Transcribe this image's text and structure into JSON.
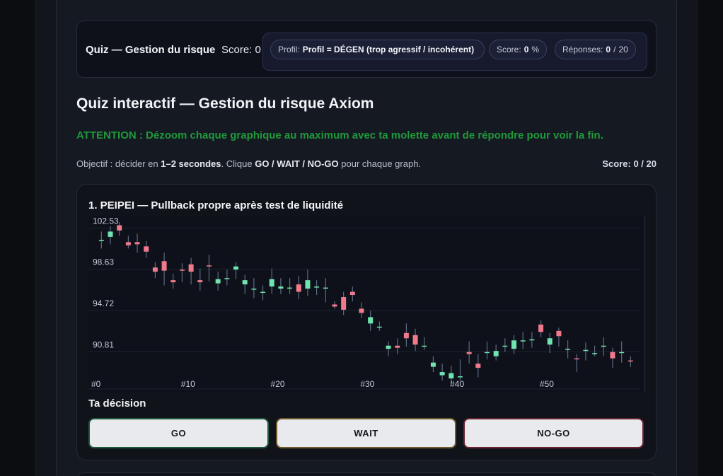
{
  "header": {
    "title": "Quiz — Gestion du risque",
    "score_text": "Score: 0",
    "profile_label": "Profil:",
    "profile_value": "Profil = DÉGEN (trop agressif / incohérent)",
    "score_label": "Score:",
    "score_value": "0",
    "score_unit": "%",
    "answers_label": "Réponses:",
    "answers_value": "0",
    "answers_sep": "/",
    "answers_total": "20"
  },
  "main": {
    "title": "Quiz interactif — Gestion du risque Axiom",
    "warning": "ATTENTION : Dézoom chaque graphique au maximum avec ta molette avant de répondre pour voir la fin.",
    "objective_prefix": "Objectif : décider en ",
    "objective_time": "1–2 secondes",
    "objective_mid": ". Clique ",
    "objective_buttons": "GO / WAIT / NO-GO",
    "objective_suffix": " pour chaque graph.",
    "score_summary": "Score: 0 / 20"
  },
  "question": {
    "title": "1. PEIPEI — Pullback propre après test de liquidité",
    "decision_label": "Ta décision",
    "buttons": {
      "go": "GO",
      "wait": "WAIT",
      "nogo": "NO-GO"
    }
  },
  "colors": {
    "up": "#6fe3b0",
    "down": "#f07a8c",
    "wick": "#5b6b86",
    "warning": "#1f9a3a",
    "chart_bg": "#0e1119"
  },
  "chart_data": {
    "type": "candlestick",
    "y_ticks": [
      "102.53",
      "98.63",
      "94.72",
      "90.81"
    ],
    "y_tick_values": [
      102.53,
      98.63,
      94.72,
      90.81
    ],
    "x_ticks": [
      "#0",
      "#10",
      "#20",
      "#30",
      "#40",
      "#50"
    ],
    "x_tick_values": [
      0,
      10,
      20,
      30,
      40,
      50
    ],
    "ylim": [
      87.9,
      103.3
    ],
    "xlim": [
      0,
      59
    ],
    "candles": [
      {
        "o": 101.4,
        "c": 101.4,
        "h": 102.2,
        "l": 100.6
      },
      {
        "o": 101.7,
        "c": 102.2,
        "h": 102.7,
        "l": 101.0
      },
      {
        "o": 102.8,
        "c": 102.3,
        "h": 103.1,
        "l": 101.8
      },
      {
        "o": 101.2,
        "c": 100.9,
        "h": 101.8,
        "l": 100.6
      },
      {
        "o": 101.2,
        "c": 101.0,
        "h": 102.0,
        "l": 100.2
      },
      {
        "o": 100.8,
        "c": 100.3,
        "h": 101.3,
        "l": 99.7
      },
      {
        "o": 98.8,
        "c": 98.4,
        "h": 99.3,
        "l": 97.8
      },
      {
        "o": 99.4,
        "c": 98.5,
        "h": 100.2,
        "l": 97.1
      },
      {
        "o": 97.6,
        "c": 97.4,
        "h": 98.2,
        "l": 96.8
      },
      {
        "o": 98.6,
        "c": 98.5,
        "h": 99.2,
        "l": 97.4
      },
      {
        "o": 99.1,
        "c": 98.4,
        "h": 99.7,
        "l": 97.2
      },
      {
        "o": 97.6,
        "c": 97.4,
        "h": 98.7,
        "l": 96.6
      },
      {
        "o": 99.0,
        "c": 98.9,
        "h": 100.0,
        "l": 97.5
      },
      {
        "o": 97.3,
        "c": 97.7,
        "h": 98.4,
        "l": 96.6
      },
      {
        "o": 97.7,
        "c": 97.8,
        "h": 98.6,
        "l": 97.1
      },
      {
        "o": 98.6,
        "c": 98.9,
        "h": 99.3,
        "l": 97.7
      },
      {
        "o": 97.2,
        "c": 97.6,
        "h": 98.1,
        "l": 96.3
      },
      {
        "o": 96.8,
        "c": 96.8,
        "h": 97.8,
        "l": 95.9
      },
      {
        "o": 96.5,
        "c": 96.5,
        "h": 97.1,
        "l": 95.7
      },
      {
        "o": 97.0,
        "c": 97.7,
        "h": 98.7,
        "l": 96.3
      },
      {
        "o": 96.8,
        "c": 97.0,
        "h": 97.8,
        "l": 96.3
      },
      {
        "o": 96.9,
        "c": 96.9,
        "h": 97.8,
        "l": 96.3
      },
      {
        "o": 97.2,
        "c": 96.5,
        "h": 98.0,
        "l": 95.8
      },
      {
        "o": 96.8,
        "c": 97.6,
        "h": 98.6,
        "l": 96.1
      },
      {
        "o": 97.0,
        "c": 97.0,
        "h": 97.6,
        "l": 96.2
      },
      {
        "o": 96.9,
        "c": 96.9,
        "h": 97.8,
        "l": 95.5
      },
      {
        "o": 95.3,
        "c": 95.1,
        "h": 95.6,
        "l": 94.9
      },
      {
        "o": 96.0,
        "c": 94.8,
        "h": 96.5,
        "l": 94.3
      },
      {
        "o": 96.5,
        "c": 96.2,
        "h": 97.0,
        "l": 95.6
      },
      {
        "o": 94.9,
        "c": 94.5,
        "h": 95.5,
        "l": 94.0
      },
      {
        "o": 93.5,
        "c": 94.1,
        "h": 94.7,
        "l": 92.8
      },
      {
        "o": 93.2,
        "c": 93.2,
        "h": 93.7,
        "l": 92.8
      },
      {
        "o": 91.1,
        "c": 91.4,
        "h": 91.8,
        "l": 90.4
      },
      {
        "o": 91.4,
        "c": 91.2,
        "h": 92.1,
        "l": 90.6
      },
      {
        "o": 92.6,
        "c": 92.1,
        "h": 93.5,
        "l": 91.3
      },
      {
        "o": 92.4,
        "c": 91.5,
        "h": 93.0,
        "l": 90.9
      },
      {
        "o": 91.4,
        "c": 91.4,
        "h": 92.2,
        "l": 91.0
      },
      {
        "o": 89.4,
        "c": 89.8,
        "h": 90.4,
        "l": 88.9
      },
      {
        "o": 88.6,
        "c": 88.9,
        "h": 89.7,
        "l": 88.1
      },
      {
        "o": 88.3,
        "c": 88.8,
        "h": 89.5,
        "l": 87.9
      },
      {
        "o": 88.5,
        "c": 88.5,
        "h": 90.1,
        "l": 88.1
      },
      {
        "o": 90.8,
        "c": 90.6,
        "h": 91.8,
        "l": 89.7
      },
      {
        "o": 89.7,
        "c": 89.3,
        "h": 90.6,
        "l": 88.4
      },
      {
        "o": 90.8,
        "c": 90.8,
        "h": 91.8,
        "l": 90.1
      },
      {
        "o": 90.4,
        "c": 90.9,
        "h": 91.5,
        "l": 90.0
      },
      {
        "o": 91.3,
        "c": 91.4,
        "h": 92.1,
        "l": 90.8
      },
      {
        "o": 91.1,
        "c": 91.9,
        "h": 92.4,
        "l": 90.6
      },
      {
        "o": 91.9,
        "c": 91.9,
        "h": 92.7,
        "l": 91.1
      },
      {
        "o": 92.0,
        "c": 92.0,
        "h": 92.7,
        "l": 91.2
      },
      {
        "o": 93.4,
        "c": 92.7,
        "h": 93.8,
        "l": 92.2
      },
      {
        "o": 91.5,
        "c": 92.1,
        "h": 92.6,
        "l": 90.7
      },
      {
        "o": 92.8,
        "c": 92.3,
        "h": 93.1,
        "l": 91.3
      },
      {
        "o": 91.1,
        "c": 91.1,
        "h": 91.9,
        "l": 90.2
      },
      {
        "o": 90.2,
        "c": 90.1,
        "h": 90.6,
        "l": 88.9
      },
      {
        "o": 91.0,
        "c": 91.0,
        "h": 91.7,
        "l": 90.0
      },
      {
        "o": 90.7,
        "c": 90.7,
        "h": 91.4,
        "l": 90.4
      },
      {
        "o": 91.3,
        "c": 91.4,
        "h": 92.2,
        "l": 90.4
      },
      {
        "o": 90.8,
        "c": 90.2,
        "h": 91.2,
        "l": 89.3
      },
      {
        "o": 90.8,
        "c": 90.8,
        "h": 91.8,
        "l": 89.8
      },
      {
        "o": 90.0,
        "c": 89.9,
        "h": 90.4,
        "l": 89.4
      }
    ]
  }
}
